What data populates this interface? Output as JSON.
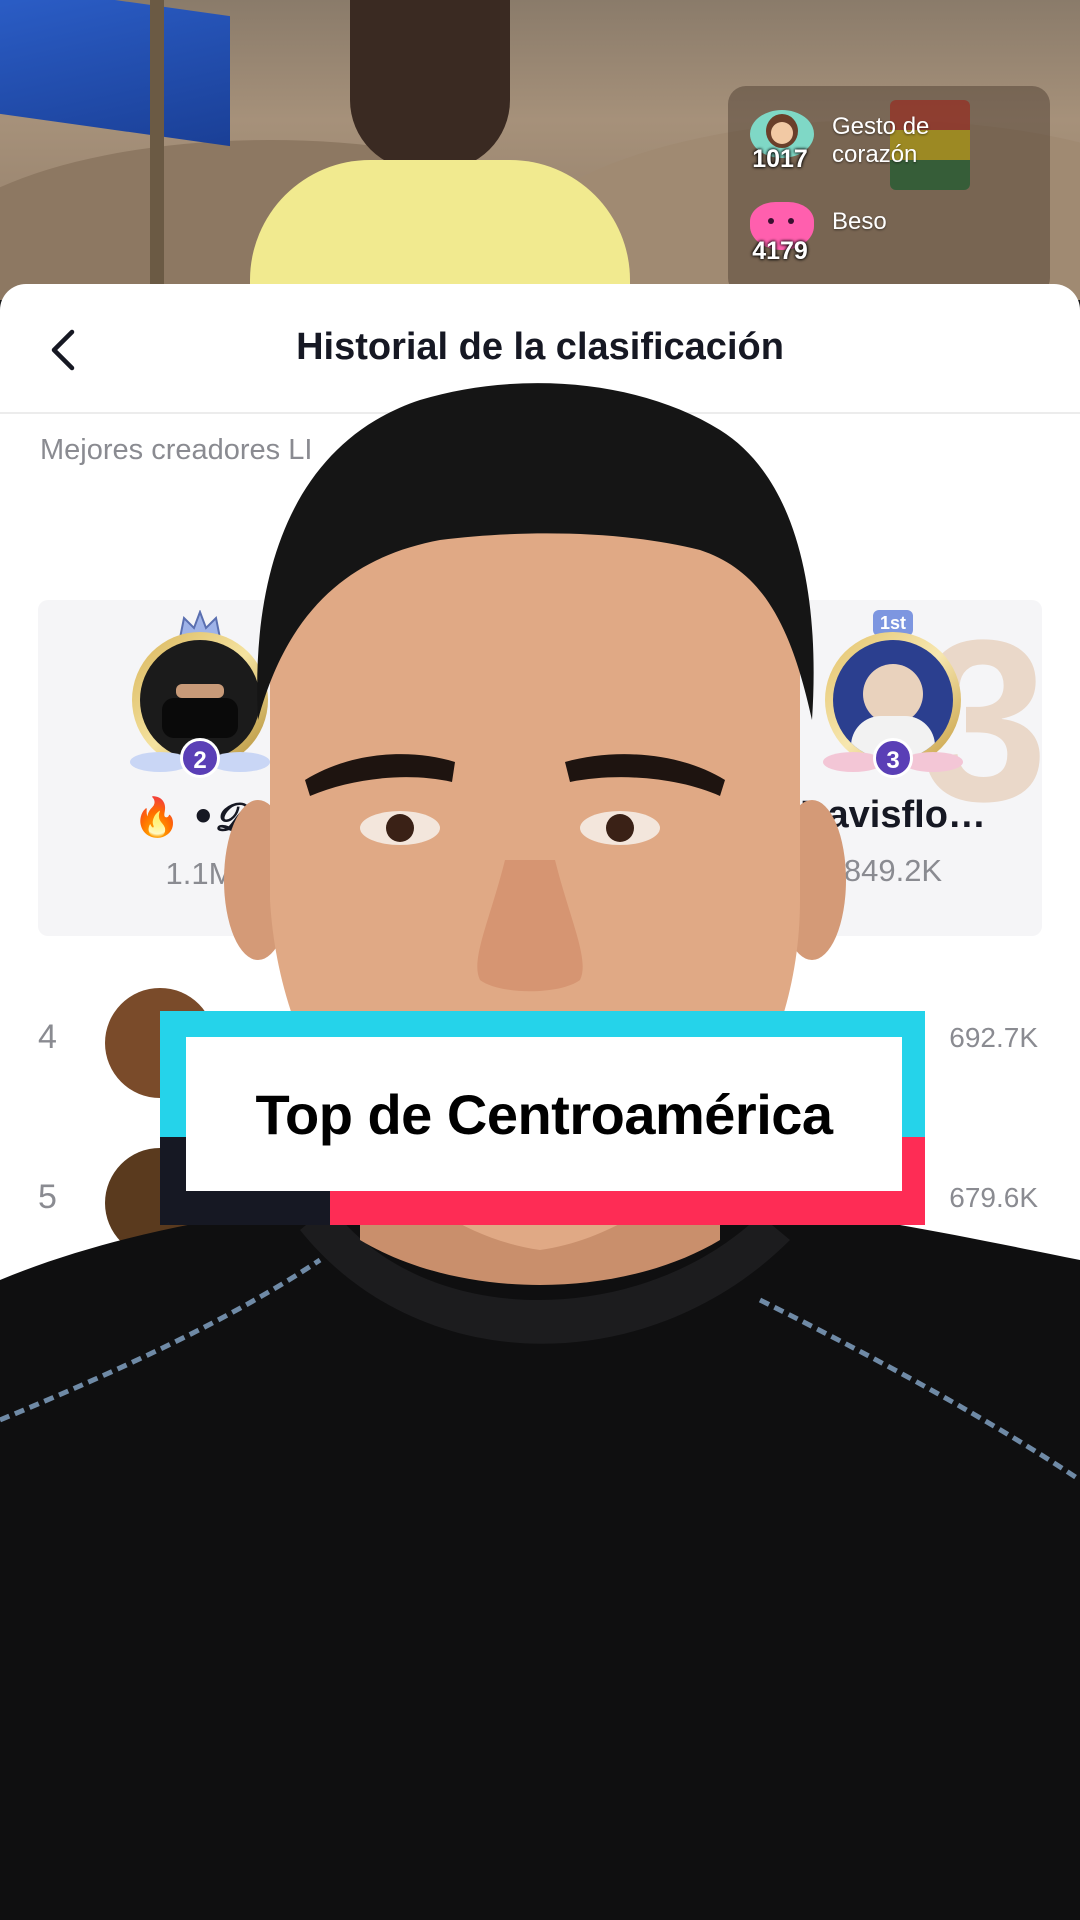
{
  "stream": {
    "gifts": [
      {
        "count": "1017",
        "label_line1": "Gesto de",
        "label_line2": "corazón",
        "icon": "heart-gesture-girl-icon",
        "color": "#7fd8c6"
      },
      {
        "count": "4179",
        "label_line1": "Beso",
        "label_line2": "",
        "icon": "kiss-heart-icon",
        "color": "#ff5fae"
      }
    ]
  },
  "sheet": {
    "title": "Historial de la clasificación",
    "section_label": "Mejores creadores LI",
    "podium": {
      "big_rank": "3",
      "first_badge": "1st",
      "slots": [
        {
          "rank": "2",
          "name": "•𝓓𝓪",
          "prefix_emoji": "🔥",
          "score": "1.1M"
        },
        {
          "rank": "3",
          "name": "Davisflo…",
          "score": "849.2K"
        }
      ]
    },
    "rows": [
      {
        "rank": "4",
        "score": "692.7K"
      },
      {
        "rank": "5",
        "score": "679.6K"
      }
    ]
  },
  "caption": {
    "text": "Top de Centroamérica"
  },
  "colors": {
    "accent_cyan": "#25d3ea",
    "accent_red": "#fe2c55",
    "dark": "#161823",
    "rank_purple": "#5a3fb6"
  }
}
